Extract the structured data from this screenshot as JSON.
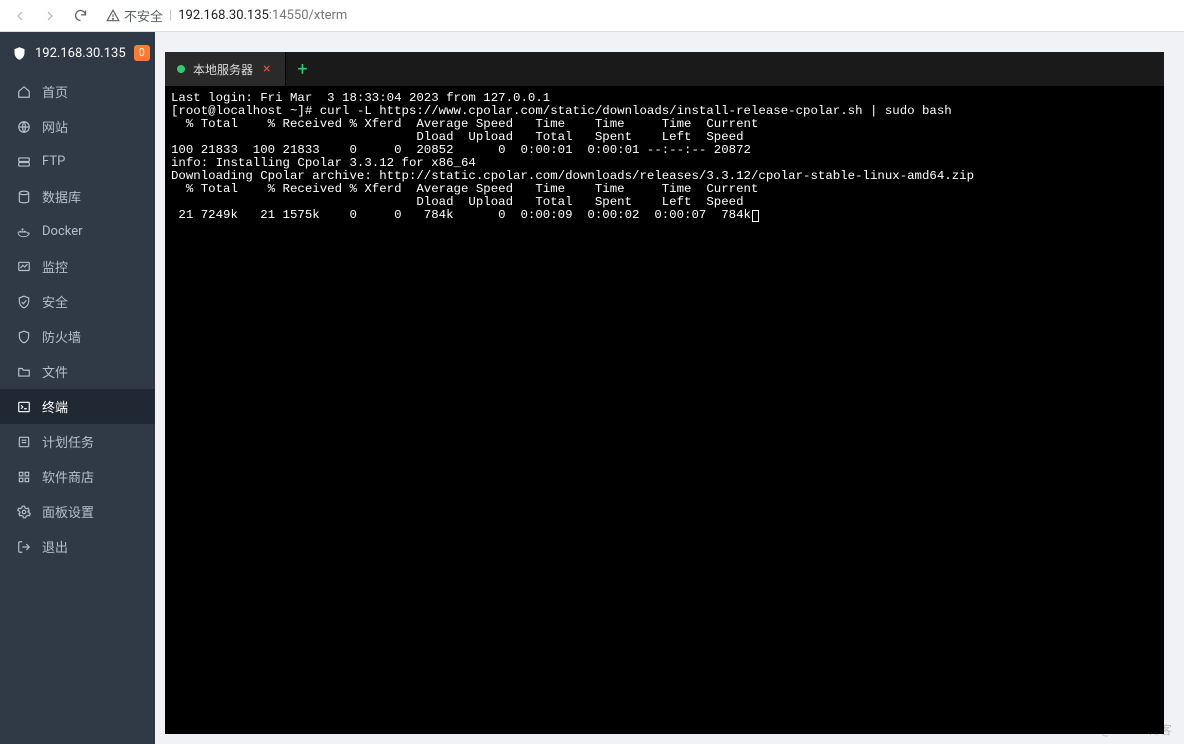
{
  "browser": {
    "insecure_label": "不安全",
    "url_host": "192.168.30.135",
    "url_port": ":14550",
    "url_path": "/xterm"
  },
  "sidebar": {
    "host": "192.168.30.135",
    "badge": "0",
    "items": [
      {
        "label": "首页"
      },
      {
        "label": "网站"
      },
      {
        "label": "FTP"
      },
      {
        "label": "数据库"
      },
      {
        "label": "Docker"
      },
      {
        "label": "监控"
      },
      {
        "label": "安全"
      },
      {
        "label": "防火墙"
      },
      {
        "label": "文件"
      },
      {
        "label": "终端"
      },
      {
        "label": "计划任务"
      },
      {
        "label": "软件商店"
      },
      {
        "label": "面板设置"
      },
      {
        "label": "退出"
      }
    ]
  },
  "tabs": {
    "active_label": "本地服务器"
  },
  "terminal": {
    "lines": [
      "Last login: Fri Mar  3 18:33:04 2023 from 127.0.0.1",
      "[root@localhost ~]# curl -L https://www.cpolar.com/static/downloads/install-release-cpolar.sh | sudo bash",
      "  % Total    % Received % Xferd  Average Speed   Time    Time     Time  Current",
      "                                 Dload  Upload   Total   Spent    Left  Speed",
      "100 21833  100 21833    0     0  20852      0  0:00:01  0:00:01 --:--:-- 20872",
      "info: Installing Cpolar 3.3.12 for x86_64",
      "Downloading Cpolar archive: http://static.cpolar.com/downloads/releases/3.3.12/cpolar-stable-linux-amd64.zip",
      "  % Total    % Received % Xferd  Average Speed   Time    Time     Time  Current",
      "                                 Dload  Upload   Total   Spent    Left  Speed",
      " 21 7249k   21 1575k    0     0   784k      0  0:00:09  0:00:02  0:00:07  784k"
    ]
  },
  "watermark": "@51CTO博客"
}
